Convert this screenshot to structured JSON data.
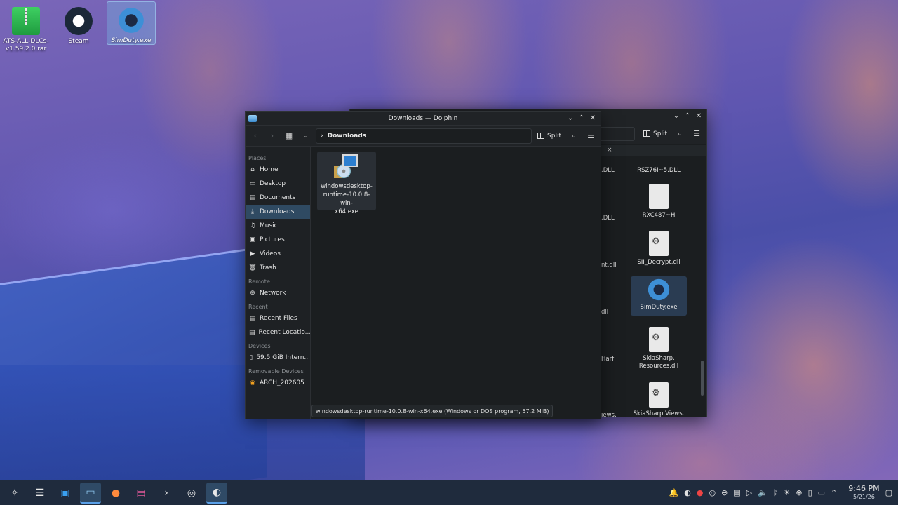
{
  "desktop": {
    "icons": [
      {
        "label": "ATS-ALL-DLCs-v1.59.2.0.rar",
        "icon": "archive-icon"
      },
      {
        "label": "Steam",
        "icon": "steam-icon"
      },
      {
        "label": "SimDuty.exe",
        "icon": "gear-app-icon"
      }
    ]
  },
  "front_window": {
    "title": "Downloads — Dolphin",
    "breadcrumb": "Downloads",
    "split_label": "Split",
    "sidebar": {
      "sections": [
        {
          "title": "Places",
          "items": [
            "Home",
            "Desktop",
            "Documents",
            "Downloads",
            "Music",
            "Pictures",
            "Videos",
            "Trash"
          ]
        },
        {
          "title": "Remote",
          "items": [
            "Network"
          ]
        },
        {
          "title": "Recent",
          "items": [
            "Recent Files",
            "Recent Locatio..."
          ]
        },
        {
          "title": "Devices",
          "items": [
            "59.5 GiB Intern..."
          ]
        },
        {
          "title": "Removable Devices",
          "items": [
            "ARCH_202605"
          ]
        }
      ],
      "active": "Downloads"
    },
    "file": {
      "line1": "windowsdesktop-",
      "line2": "runtime-10.0.8-win-",
      "line3": "x64.exe"
    },
    "status": "windowsdesktop-runtime-10.0.8-win-x64.exe (Windows or DOS program, 57.2 MiB)"
  },
  "back_window": {
    "split_label": "Split",
    "tab_close": "×",
    "files": [
      {
        "name": "RSZ76I~5.DLL"
      },
      {
        "name": "RXC487~H"
      },
      {
        "name": "SII_Decrypt.dll"
      },
      {
        "name": "SimDuty.exe"
      },
      {
        "name": "SkiaSharp.Resources.dll",
        "line1": "SkiaSharp.",
        "line2": "Resources.dll"
      },
      {
        "name": "SkiaSharp.Views."
      }
    ],
    "fragments": [
      ".DLL",
      ".DLL",
      "nt.dll",
      "dll",
      "Harf",
      "iews."
    ]
  },
  "taskbar": {
    "apps": [
      "launcher-icon",
      "settings-icon",
      "store-icon",
      "dolphin-icon",
      "firefox-icon",
      "media-icon",
      "terminal-icon",
      "steam-icon",
      "obs-icon"
    ],
    "clock_time": "9:46 PM",
    "clock_date": "5/21/26"
  }
}
